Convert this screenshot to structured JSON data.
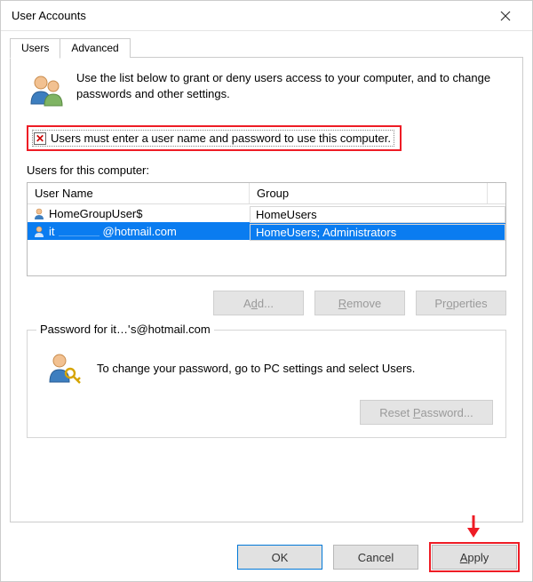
{
  "window": {
    "title": "User Accounts"
  },
  "tabs": {
    "users": "Users",
    "advanced": "Advanced"
  },
  "intro_text": "Use the list below to grant or deny users access to your computer, and to change passwords and other settings.",
  "checkbox": {
    "label": "Users must enter a user name and password to use this computer.",
    "checked_glyph": "✕"
  },
  "list": {
    "caption_prefix": "Users for this computer:",
    "col_user": "User Name",
    "col_group": "Group",
    "rows": [
      {
        "name": "HomeGroupUser$",
        "group": "HomeUsers",
        "selected": false
      },
      {
        "name_prefix": "it",
        "name_suffix": "@hotmail.com",
        "group": "HomeUsers; Administrators",
        "selected": true
      }
    ]
  },
  "buttons": {
    "add": "Add...",
    "remove": "Remove",
    "properties": "Properties",
    "reset": "Reset Password...",
    "ok": "OK",
    "cancel": "Cancel",
    "apply": "Apply"
  },
  "password_group": {
    "title_prefix": "Password for it",
    "title_suffix": "s@hotmail.com",
    "text": "To change your password, go to PC settings and select Users."
  },
  "annotations": {
    "checkbox_highlight_color": "#ee1c25",
    "apply_highlight_color": "#ee1c25"
  }
}
